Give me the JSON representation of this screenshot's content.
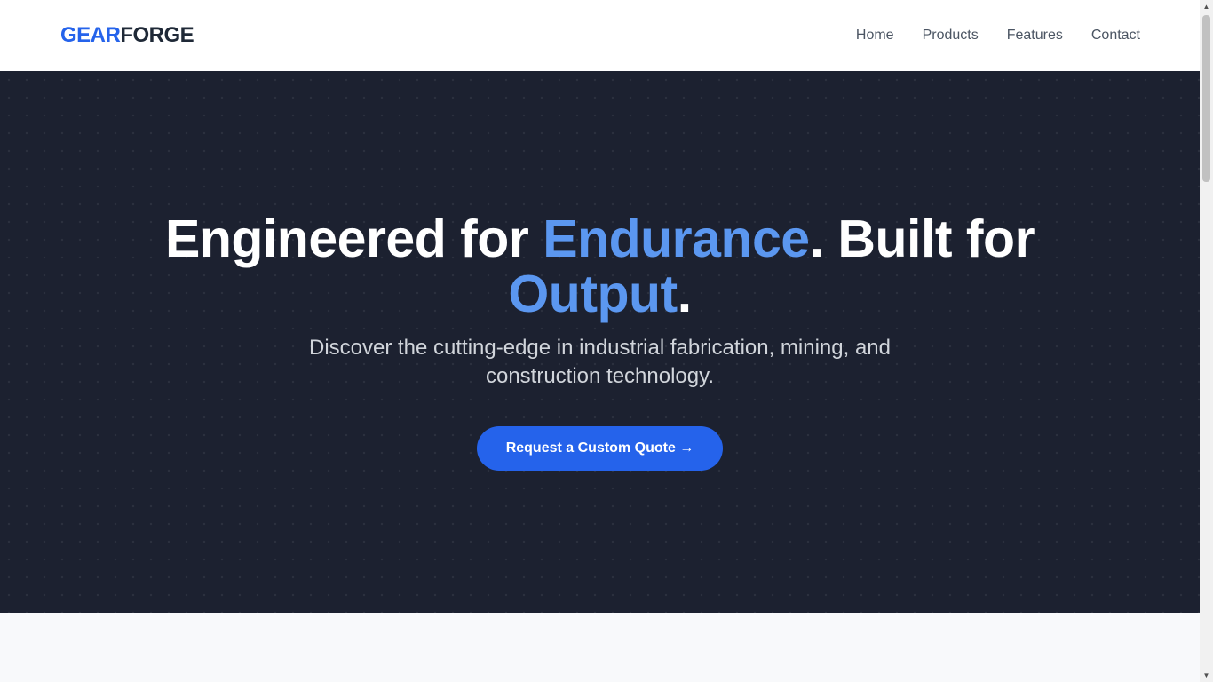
{
  "brand": {
    "part1": "GEAR",
    "part2": "FORGE"
  },
  "nav": {
    "items": [
      {
        "label": "Home"
      },
      {
        "label": "Products"
      },
      {
        "label": "Features"
      },
      {
        "label": "Contact"
      }
    ]
  },
  "hero": {
    "headline": {
      "t1": "Engineered for ",
      "h1": "Endurance",
      "t2": ". Built for ",
      "h2": "Output",
      "t3": "."
    },
    "subtitle": "Discover the cutting-edge in industrial fabrication, mining, and construction technology.",
    "cta_label": "Request a Custom Quote →"
  },
  "colors": {
    "accent": "#2563eb",
    "highlight": "#5b97f0",
    "hero_bg": "#1c2130",
    "logo_dark": "#1f2937"
  },
  "scrollbar": {
    "up_icon": "arrow-up-icon",
    "down_icon": "arrow-down-icon"
  }
}
